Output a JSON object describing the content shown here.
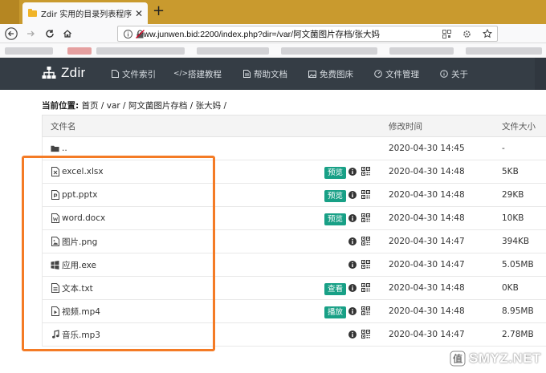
{
  "browser": {
    "tab_title": "Zdir 实用的目录列表程序",
    "url": "www.junwen.bid:2200/index.php?dir=/var/阿文菌图片存档/张大妈"
  },
  "site": {
    "brand": "Zdir",
    "menu": [
      {
        "label": "文件索引",
        "icon": "file-icon"
      },
      {
        "label": "搭建教程",
        "icon": "code-icon"
      },
      {
        "label": "帮助文档",
        "icon": "document-icon"
      },
      {
        "label": "免费图床",
        "icon": "image-icon"
      },
      {
        "label": "文件管理",
        "icon": "dashboard-icon"
      },
      {
        "label": "关于",
        "icon": "info-icon"
      }
    ]
  },
  "breadcrumb": {
    "label": "当前位置:",
    "path": "首页 / var / 阿文菌图片存档 / 张大妈 /"
  },
  "table": {
    "headers": {
      "name": "文件名",
      "modified": "修改时间",
      "size": "文件大小"
    },
    "rows": [
      {
        "name": "..",
        "type": "folder",
        "action": "",
        "info": false,
        "qr": false,
        "modified": "2020-04-30 14:45",
        "size": "-"
      },
      {
        "name": "excel.xlsx",
        "type": "excel",
        "action": "预览",
        "info": true,
        "qr": true,
        "modified": "2020-04-30 14:48",
        "size": "5KB"
      },
      {
        "name": "ppt.pptx",
        "type": "ppt",
        "action": "预览",
        "info": true,
        "qr": true,
        "modified": "2020-04-30 14:48",
        "size": "29KB"
      },
      {
        "name": "word.docx",
        "type": "word",
        "action": "预览",
        "info": true,
        "qr": true,
        "modified": "2020-04-30 14:48",
        "size": "10KB"
      },
      {
        "name": "图片.png",
        "type": "image",
        "action": "",
        "info": true,
        "qr": true,
        "modified": "2020-04-30 14:47",
        "size": "394KB"
      },
      {
        "name": "应用.exe",
        "type": "windows",
        "action": "",
        "info": true,
        "qr": true,
        "modified": "2020-04-30 14:47",
        "size": "5.05MB"
      },
      {
        "name": "文本.txt",
        "type": "text",
        "action": "查看",
        "info": true,
        "qr": true,
        "modified": "2020-04-30 14:48",
        "size": "0KB"
      },
      {
        "name": "视频.mp4",
        "type": "video",
        "action": "播放",
        "info": true,
        "qr": true,
        "modified": "2020-04-30 14:48",
        "size": "8.95MB"
      },
      {
        "name": "音乐.mp3",
        "type": "music",
        "action": "",
        "info": true,
        "qr": true,
        "modified": "2020-04-30 14:47",
        "size": "2.78MB"
      }
    ]
  },
  "watermark": {
    "text": "SMYZ.NET"
  },
  "colors": {
    "accent": "#18a086",
    "header_bg": "#353d45",
    "highlight": "#f47b25",
    "tabbar": "#c99a2e"
  }
}
